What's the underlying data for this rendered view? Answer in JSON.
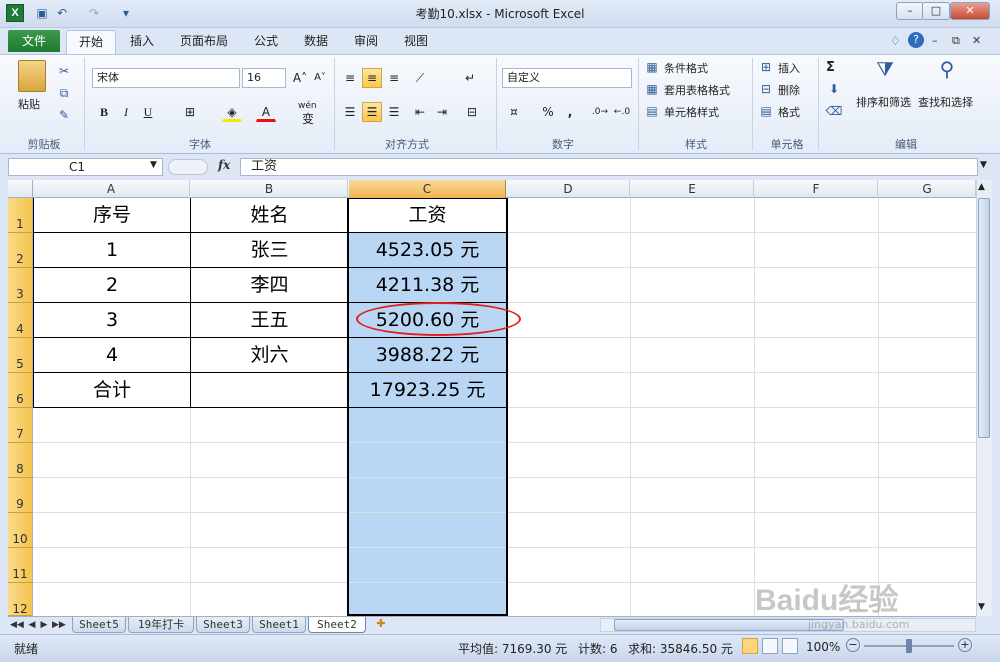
{
  "window": {
    "title": "考勤10.xlsx - Microsoft Excel",
    "app_icon": "X",
    "min": "–",
    "max": "□",
    "close": "✕"
  },
  "quick_access": [
    "save-icon",
    "undo-icon",
    "redo-icon",
    "customize-icon"
  ],
  "tabs": [
    "文件",
    "开始",
    "插入",
    "页面布局",
    "公式",
    "数据",
    "审阅",
    "视图"
  ],
  "ribbon": {
    "clipboard": {
      "paste": "粘贴",
      "label": "剪贴板"
    },
    "font": {
      "name": "宋体",
      "size": "16",
      "bold": "B",
      "italic": "I",
      "underline": "U",
      "wen": "wén",
      "wen_char": "变",
      "label": "字体"
    },
    "align": {
      "label": "对齐方式"
    },
    "number": {
      "format": "自定义",
      "percent": "%",
      "comma": ",",
      "label": "数字"
    },
    "styles": {
      "cond": "条件格式",
      "table": "套用表格格式",
      "cell": "单元格样式",
      "label": "样式"
    },
    "cells": {
      "insert": "插入",
      "delete": "删除",
      "format": "格式",
      "label": "单元格"
    },
    "edit": {
      "sort": "排序和筛选",
      "find": "查找和选择",
      "sigma": "Σ",
      "label": "编辑"
    }
  },
  "formula_bar": {
    "name_box": "C1",
    "fx": "fx",
    "value": "工资"
  },
  "columns": [
    "A",
    "B",
    "C",
    "D",
    "E",
    "F",
    "G"
  ],
  "rows": [
    "1",
    "2",
    "3",
    "4",
    "5",
    "6",
    "7",
    "8",
    "9",
    "10",
    "11",
    "12"
  ],
  "table": {
    "header": [
      "序号",
      "姓名",
      "工资"
    ],
    "body": [
      [
        "1",
        "张三",
        "4523.05 元"
      ],
      [
        "2",
        "李四",
        "4211.38 元"
      ],
      [
        "3",
        "王五",
        "5200.60 元"
      ],
      [
        "4",
        "刘六",
        "3988.22 元"
      ],
      [
        "合计",
        "",
        "17923.25 元"
      ]
    ]
  },
  "sheets": [
    "Sheet5",
    "19年打卡",
    "Sheet3",
    "Sheet1",
    "Sheet2"
  ],
  "active_sheet": "Sheet2",
  "status": {
    "ready": "就绪",
    "average": "平均值: 7169.30 元",
    "count": "计数: 6",
    "sum": "求和: 35846.50 元",
    "zoom": "100%"
  },
  "watermark": "Baidu经验",
  "watermark_url": "jingyan.baidu.com",
  "colors": {
    "selection": "#b9d7f5",
    "accent_file": "#1f7a33",
    "annotation": "#e02020"
  }
}
